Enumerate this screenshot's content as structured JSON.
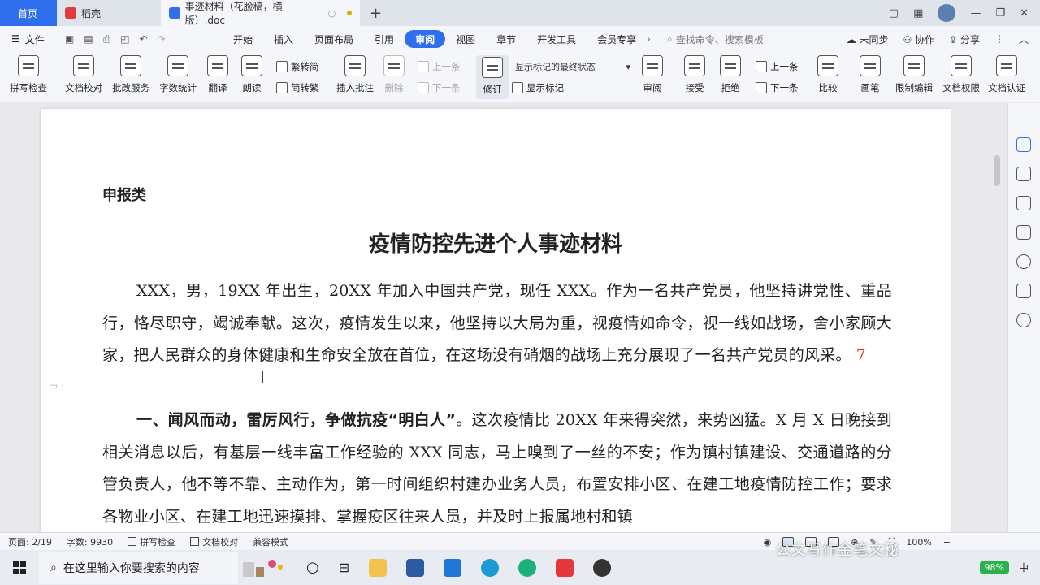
{
  "tabs": {
    "home": "首页",
    "docer": "稻壳",
    "active": "事迹材料（花脸稿，横版）.doc"
  },
  "menu": {
    "file": "文件",
    "items": [
      "开始",
      "插入",
      "页面布局",
      "引用",
      "审阅",
      "视图",
      "章节",
      "开发工具",
      "会员专享"
    ],
    "active_index": 4,
    "search": "查找命令、搜索模板",
    "unsynced": "未同步",
    "collab": "协作",
    "share": "分享"
  },
  "ribbon": {
    "spellcheck": "拼写检查",
    "doc_proofread": "文档校对",
    "batch_service": "批改服务",
    "word_count": "字数统计",
    "translate": "翻译",
    "read_aloud": "朗读",
    "trad_to_simp": "繁转简",
    "simp_to_trad": "简转繁",
    "insert_comment": "插入批注",
    "delete": "删除",
    "prev_comment": "上一条",
    "next_comment": "下一条",
    "revise": "修订",
    "show_markup_state": "显示标记的最终状态",
    "show_markup": "显示标记",
    "review": "审阅",
    "accept": "接受",
    "reject": "拒绝",
    "prev_change": "上一条",
    "next_change": "下一条",
    "compare": "比较",
    "ink": "画笔",
    "restrict_edit": "限制编辑",
    "doc_rights": "文档权限",
    "doc_cert": "文档认证"
  },
  "document": {
    "category": "申报类",
    "title": "疫情防控先进个人事迹材料",
    "para1": "XXX，男，19XX 年出生，20XX 年加入中国共产党，现任 XXX。作为一名共产党员，他坚持讲党性、重品行，恪尽职守，竭诚奉献。这次，疫情发生以来，他坚持以大局为重，视疫情如命令，视一线如战场，舍小家顾大家，把人民群众的身体健康和生命安全放在首位，在这场没有硝烟的战场上充分展现了一名共产党员的风采。",
    "para1_mark": "7",
    "para2_heading": "一、闻风而动，雷厉风行，争做抗疫“明白人”",
    "para2_body": "。这次疫情比 20XX 年来得突然，来势凶猛。X 月 X 日晚接到相关消息以后，有基层一线丰富工作经验的 XXX 同志，马上嗅到了一丝的不安；作为镇村镇建设、交通道路的分管负责人，他不等不靠、主动作为，第一时间组织村建办业务人员，布置安排小区、在建工地疫情防控工作；要求各物业小区、在建工地迅速摸排、掌握疫区往来人员，并及时上报属地村和镇"
  },
  "status": {
    "page": "页面: 2/19",
    "word_count": "字数: 9930",
    "spellcheck": "拼写检查",
    "proofread": "文档校对",
    "compat": "兼容模式",
    "zoom": "100%"
  },
  "taskbar": {
    "search_placeholder": "在这里输入你要搜索的内容",
    "battery": "98%",
    "ime": "中",
    "watermark": "公文写作金笔文秘"
  }
}
